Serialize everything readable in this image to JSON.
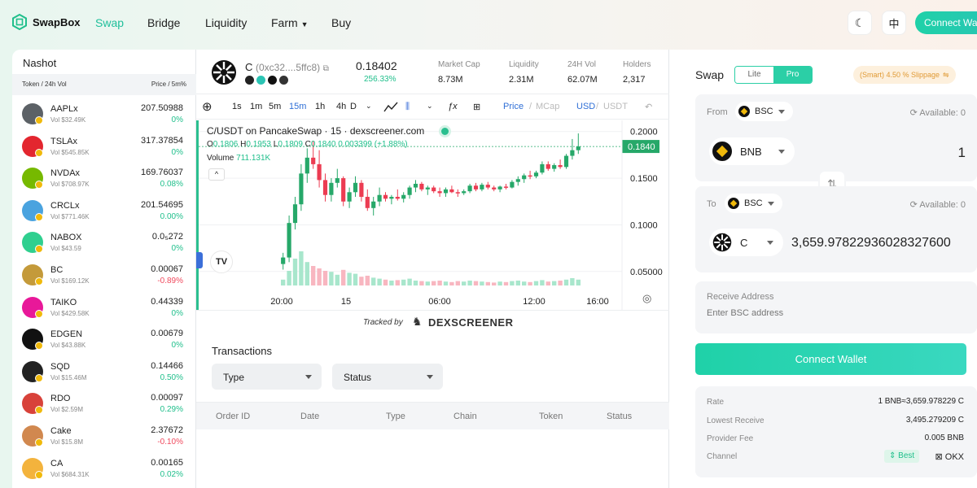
{
  "brand": {
    "name": "SwapBox"
  },
  "nav": {
    "items": [
      {
        "label": "Swap"
      },
      {
        "label": "Bridge"
      },
      {
        "label": "Liquidity"
      },
      {
        "label": "Farm"
      },
      {
        "label": "Buy"
      }
    ]
  },
  "header": {
    "lang": "中",
    "connect": "Connect Wallet"
  },
  "left": {
    "title": "Nashot",
    "col_token": "Token / 24h Vol",
    "col_price": "Price / 5m%",
    "tokens": [
      {
        "name": "AAPLx",
        "vol": "Vol $32.49K",
        "price": "207.50988",
        "change": "0%",
        "dir": "up",
        "color": "#5c6166"
      },
      {
        "name": "TSLAx",
        "vol": "Vol $545.85K",
        "price": "317.37854",
        "change": "0%",
        "dir": "up",
        "color": "#e3262f"
      },
      {
        "name": "NVDAx",
        "vol": "Vol $708.97K",
        "price": "169.76037",
        "change": "0.08%",
        "dir": "up",
        "color": "#76b900"
      },
      {
        "name": "CRCLx",
        "vol": "Vol $771.46K",
        "price": "201.54695",
        "change": "0.00%",
        "dir": "up",
        "color": "#4aa3df"
      },
      {
        "name": "NABOX",
        "vol": "Vol $43.59",
        "price": "0.0₅272",
        "change": "0%",
        "dir": "up",
        "color": "#2fcf8f"
      },
      {
        "name": "BC",
        "vol": "Vol $169.12K",
        "price": "0.00067",
        "change": "-0.89%",
        "dir": "down",
        "color": "#c49a3a"
      },
      {
        "name": "TAIKO",
        "vol": "Vol $429.58K",
        "price": "0.44339",
        "change": "0%",
        "dir": "up",
        "color": "#e81899"
      },
      {
        "name": "EDGEN",
        "vol": "Vol $43.88K",
        "price": "0.00679",
        "change": "0%",
        "dir": "up",
        "color": "#111111"
      },
      {
        "name": "SQD",
        "vol": "Vol $15.46M",
        "price": "0.14466",
        "change": "0.50%",
        "dir": "up",
        "color": "#222222"
      },
      {
        "name": "RDO",
        "vol": "Vol $2.59M",
        "price": "0.00097",
        "change": "0.29%",
        "dir": "up",
        "color": "#d8423a"
      },
      {
        "name": "Cake",
        "vol": "Vol $15.8M",
        "price": "2.37672",
        "change": "-0.10%",
        "dir": "down",
        "color": "#d1884f"
      },
      {
        "name": "CA",
        "vol": "Vol $684.31K",
        "price": "0.00165",
        "change": "0.02%",
        "dir": "up",
        "color": "#f3b33d"
      }
    ]
  },
  "token_info": {
    "symbol": "C",
    "address": "(0xc32....5ffc8)",
    "price": "0.18402",
    "change": "256.33%",
    "stats": [
      {
        "label": "Market Cap",
        "value": "8.73M"
      },
      {
        "label": "Liquidity",
        "value": "2.31M"
      },
      {
        "label": "24H Vol",
        "value": "62.07M"
      },
      {
        "label": "Holders",
        "value": "2,317"
      }
    ]
  },
  "toolbar": {
    "intervals": [
      "1s",
      "1m",
      "5m",
      "15m",
      "1h",
      "4h",
      "D"
    ],
    "active_interval": "15m",
    "price": "Price",
    "mcap": "MCap",
    "usd": "USD",
    "usdt": "USDT"
  },
  "chart": {
    "title": "C/USDT on PancakeSwap · 15 · dexscreener.com",
    "o": "0.1806",
    "h": "0.1953",
    "l": "0.1809",
    "c": "0.1840",
    "chg": "0.003399 (+1.88%)",
    "volume_label": "Volume",
    "volume_value": "711.131K",
    "y_ticks": [
      "0.2000",
      "0.1500",
      "0.1000",
      "0.05000"
    ],
    "last_price": "0.1840",
    "x_ticks": [
      "20:00",
      "15",
      "06:00",
      "12:00",
      "16:00"
    ],
    "tracked_by": "Tracked by",
    "dex": "DEXSCREENER",
    "chart_data": {
      "type": "candlestick",
      "series": [
        {
          "name": "C/USDT",
          "ohlc": [
            [
              0.058,
              0.07,
              0.052,
              0.065
            ],
            [
              0.065,
              0.11,
              0.06,
              0.102
            ],
            [
              0.102,
              0.13,
              0.095,
              0.122
            ],
            [
              0.122,
              0.165,
              0.115,
              0.155
            ],
            [
              0.155,
              0.182,
              0.145,
              0.172
            ],
            [
              0.172,
              0.19,
              0.16,
              0.165
            ],
            [
              0.165,
              0.18,
              0.14,
              0.148
            ],
            [
              0.148,
              0.155,
              0.125,
              0.132
            ],
            [
              0.132,
              0.15,
              0.125,
              0.145
            ],
            [
              0.145,
              0.16,
              0.14,
              0.15
            ],
            [
              0.15,
              0.152,
              0.12,
              0.125
            ],
            [
              0.125,
              0.14,
              0.118,
              0.135
            ],
            [
              0.135,
              0.152,
              0.13,
              0.145
            ],
            [
              0.145,
              0.148,
              0.125,
              0.13
            ],
            [
              0.13,
              0.138,
              0.115,
              0.118
            ],
            [
              0.118,
              0.13,
              0.11,
              0.125
            ],
            [
              0.125,
              0.14,
              0.12,
              0.132
            ],
            [
              0.132,
              0.135,
              0.125,
              0.128
            ],
            [
              0.128,
              0.132,
              0.122,
              0.13
            ],
            [
              0.13,
              0.138,
              0.126,
              0.128
            ],
            [
              0.128,
              0.135,
              0.124,
              0.132
            ],
            [
              0.132,
              0.142,
              0.128,
              0.14
            ],
            [
              0.14,
              0.148,
              0.135,
              0.144
            ],
            [
              0.144,
              0.146,
              0.136,
              0.138
            ],
            [
              0.138,
              0.142,
              0.132,
              0.14
            ],
            [
              0.14,
              0.142,
              0.134,
              0.136
            ],
            [
              0.136,
              0.14,
              0.13,
              0.134
            ],
            [
              0.134,
              0.14,
              0.13,
              0.138
            ],
            [
              0.138,
              0.142,
              0.134,
              0.135
            ],
            [
              0.135,
              0.138,
              0.13,
              0.134
            ],
            [
              0.134,
              0.138,
              0.132,
              0.136
            ],
            [
              0.136,
              0.144,
              0.134,
              0.142
            ],
            [
              0.142,
              0.145,
              0.136,
              0.138
            ],
            [
              0.138,
              0.145,
              0.136,
              0.143
            ],
            [
              0.143,
              0.146,
              0.138,
              0.14
            ],
            [
              0.14,
              0.142,
              0.136,
              0.138
            ],
            [
              0.138,
              0.142,
              0.135,
              0.141
            ],
            [
              0.141,
              0.144,
              0.138,
              0.14
            ],
            [
              0.14,
              0.148,
              0.139,
              0.146
            ],
            [
              0.146,
              0.152,
              0.142,
              0.149
            ],
            [
              0.149,
              0.155,
              0.145,
              0.153
            ],
            [
              0.153,
              0.158,
              0.149,
              0.152
            ],
            [
              0.152,
              0.158,
              0.15,
              0.156
            ],
            [
              0.156,
              0.168,
              0.154,
              0.165
            ],
            [
              0.165,
              0.168,
              0.158,
              0.16
            ],
            [
              0.16,
              0.166,
              0.157,
              0.164
            ],
            [
              0.164,
              0.17,
              0.16,
              0.162
            ],
            [
              0.162,
              0.176,
              0.16,
              0.174
            ],
            [
              0.174,
              0.192,
              0.17,
              0.18
            ],
            [
              0.18,
              0.198,
              0.176,
              0.184
            ]
          ]
        }
      ],
      "volume": [
        12,
        30,
        55,
        70,
        48,
        40,
        35,
        30,
        28,
        22,
        32,
        26,
        24,
        18,
        20,
        16,
        14,
        12,
        10,
        11,
        12,
        14,
        10,
        9,
        8,
        9,
        10,
        8,
        7,
        9,
        8,
        10,
        9,
        8,
        7,
        6,
        8,
        7,
        9,
        10,
        8,
        7,
        9,
        11,
        8,
        9,
        10,
        12,
        15,
        12
      ],
      "ylim": [
        0.035,
        0.205
      ]
    }
  },
  "transactions": {
    "title": "Transactions",
    "filter_type": "Type",
    "filter_status": "Status",
    "columns": [
      "Order ID",
      "Date",
      "Type",
      "Chain",
      "Token",
      "Status"
    ]
  },
  "swap": {
    "title": "Swap",
    "mode_lite": "Lite",
    "mode_pro": "Pro",
    "slippage": "(Smart) 4.50 % Slippage",
    "from_label": "From",
    "from_chain": "BSC",
    "available_label": "Available: 0",
    "from_token": "BNB",
    "from_amount": "1",
    "to_label": "To",
    "to_chain": "BSC",
    "to_token": "C",
    "to_amount": "3,659.97822936028327600",
    "receive_label": "Receive Address",
    "receive_placeholder": "Enter BSC address",
    "connect": "Connect Wallet",
    "details": [
      {
        "label": "Rate",
        "value": "1 BNB≈3,659.978229 C"
      },
      {
        "label": "Lowest Receive",
        "value": "3,495.279209 C"
      },
      {
        "label": "Provider Fee",
        "value": "0.005 BNB"
      }
    ],
    "channel_label": "Channel",
    "channel_tag": "Best",
    "channel_name": "OKX"
  }
}
